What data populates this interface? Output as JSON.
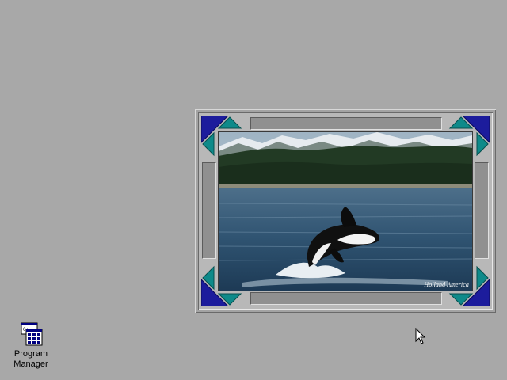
{
  "desktop": {
    "background_color": "#a8a8a8",
    "icons": [
      {
        "label_line1": "Program",
        "label_line2": "Manager",
        "icon": "program-manager-icon"
      }
    ]
  },
  "picture": {
    "watermark": "Holland America",
    "frame_colors": {
      "corner_dark": "#1c1c9c",
      "corner_teal": "#0e8a8a"
    }
  },
  "cursor": {
    "icon": "arrow-pointer-icon"
  }
}
